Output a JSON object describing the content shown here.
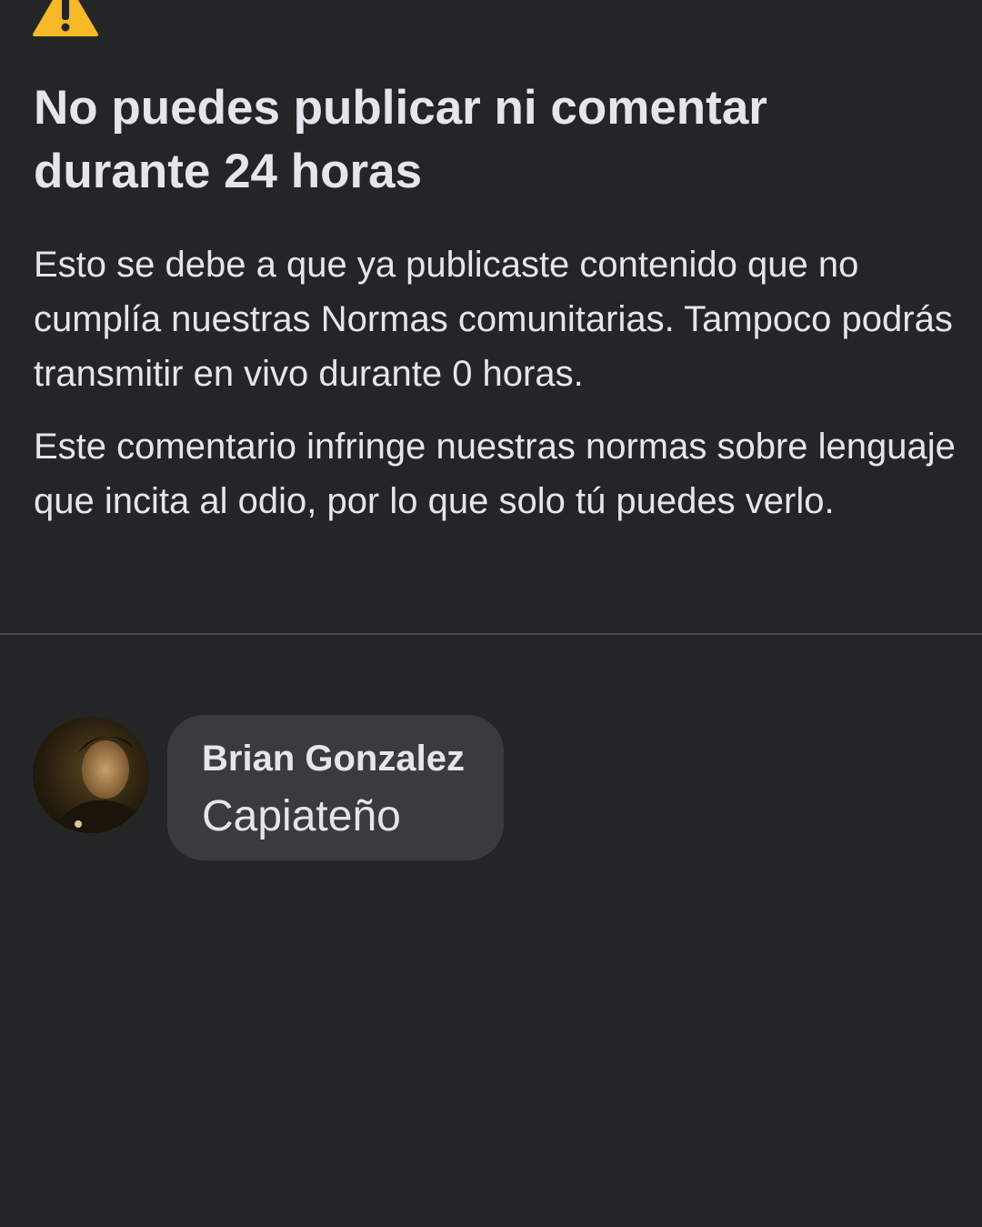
{
  "notice": {
    "icon": "warning-icon",
    "icon_color": "#f7b928",
    "title": "No puedes publicar ni comentar durante 24 horas",
    "paragraph_1": "Esto se debe a que ya publicaste contenido que no cumplía nuestras Normas comunitarias. Tampoco podrás transmitir en vivo durante 0 horas.",
    "paragraph_2": "Este comentario infringe nuestras normas sobre lenguaje que incita al odio, por lo que solo tú puedes verlo."
  },
  "comment": {
    "avatar": "user-avatar",
    "author": "Brian Gonzalez",
    "text": "Capiateño"
  }
}
